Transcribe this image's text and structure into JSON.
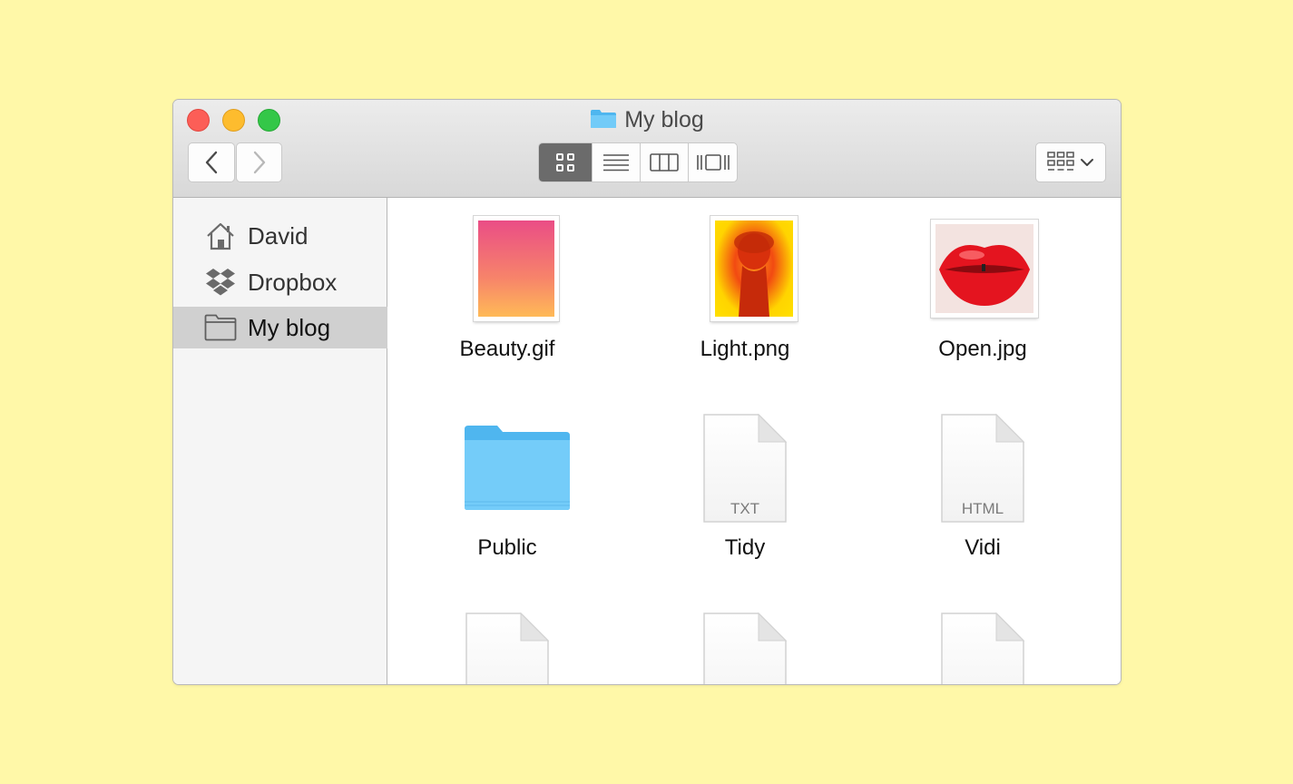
{
  "window": {
    "title": "My blog",
    "title_icon": "folder-icon"
  },
  "toolbar": {
    "back_icon": "chevron-left-icon",
    "forward_icon": "chevron-right-icon",
    "view_modes": [
      "icon-view-icon",
      "list-view-icon",
      "column-view-icon",
      "cover-flow-icon"
    ],
    "active_view": "icon-view-icon",
    "arrange_icon": "arrange-grid-icon"
  },
  "sidebar": {
    "items": [
      {
        "label": "David",
        "icon": "home-icon"
      },
      {
        "label": "Dropbox",
        "icon": "dropbox-icon"
      },
      {
        "label": "My blog",
        "icon": "folder-icon",
        "selected": true
      }
    ]
  },
  "files": [
    {
      "name": "Beauty.gif",
      "kind": "image"
    },
    {
      "name": "Light.png",
      "kind": "image"
    },
    {
      "name": "Open.jpg",
      "kind": "image"
    },
    {
      "name": "Public",
      "kind": "folder"
    },
    {
      "name": "Tidy",
      "kind": "document",
      "ext": "TXT"
    },
    {
      "name": "Vidi",
      "kind": "document",
      "ext": "HTML"
    },
    {
      "name": "",
      "kind": "document"
    },
    {
      "name": "",
      "kind": "document"
    },
    {
      "name": "",
      "kind": "document"
    }
  ],
  "colors": {
    "background": "#fff8a8",
    "folder_blue": "#6cc8f7",
    "close": "#fc5e57",
    "minimize": "#fdbc2e",
    "maximize": "#34c748"
  }
}
